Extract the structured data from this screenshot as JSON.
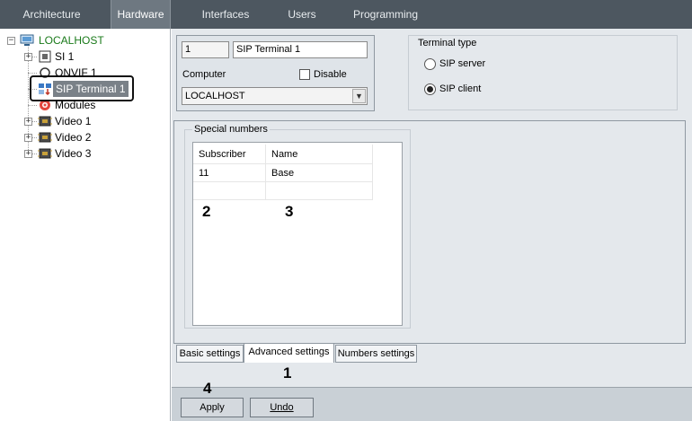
{
  "top_tabs": [
    {
      "label": "Architecture"
    },
    {
      "label": "Hardware"
    },
    {
      "label": "Interfaces"
    },
    {
      "label": "Users"
    },
    {
      "label": "Programming"
    }
  ],
  "active_top_tab": "Hardware",
  "tree": {
    "root": "LOCALHOST",
    "items": [
      {
        "label": "SI 1",
        "icon": "si-board-icon"
      },
      {
        "label": "ONVIF 1",
        "icon": "onvif-icon"
      },
      {
        "label": "SIP Terminal 1",
        "icon": "sip-terminal-icon",
        "selected": true
      },
      {
        "label": "Modules",
        "icon": "modules-icon"
      },
      {
        "label": "Video 1",
        "icon": "video-card-icon"
      },
      {
        "label": "Video 2",
        "icon": "video-card-icon"
      },
      {
        "label": "Video 3",
        "icon": "video-card-icon"
      }
    ]
  },
  "device": {
    "id": "1",
    "name": "SIP Terminal 1",
    "computer_label": "Computer",
    "disable_label": "Disable",
    "computer_value": "LOCALHOST"
  },
  "terminal_type": {
    "title": "Terminal type",
    "options": [
      {
        "label": "SIP server",
        "checked": false
      },
      {
        "label": "SIP client",
        "checked": true
      }
    ]
  },
  "special_numbers": {
    "title": "Special numbers",
    "columns": [
      "Subscriber",
      "Name"
    ],
    "rows": [
      [
        "11",
        "Base"
      ]
    ]
  },
  "bottom_tabs": [
    {
      "label": "Basic settings"
    },
    {
      "label": "Advanced settings"
    },
    {
      "label": "Numbers settings"
    }
  ],
  "active_bottom_tab": "Advanced settings",
  "buttons": {
    "apply": "Apply",
    "undo": "Undo"
  },
  "callouts": {
    "c1": "1",
    "c2": "2",
    "c3": "3",
    "c4": "4"
  }
}
